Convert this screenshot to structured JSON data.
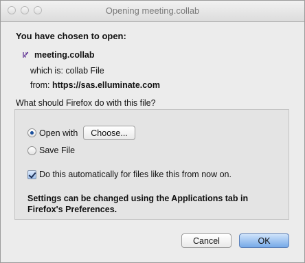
{
  "window": {
    "title": "Opening meeting.collab"
  },
  "dialog": {
    "heading": "You have chosen to open:",
    "file_name": "meeting.collab",
    "which_is_label": "which is:",
    "which_is_value": "collab File",
    "from_label": "from:",
    "from_value": "https://sas.elluminate.com",
    "question": "What should Firefox do with this file?"
  },
  "options": {
    "open_with_label": "Open with",
    "choose_button": "Choose...",
    "save_file_label": "Save File",
    "auto_label": "Do this automatically for files like this from now on.",
    "settings_note": "Settings can be changed using the Applications tab in Firefox's Preferences.",
    "selected": "open_with",
    "auto_checked": true
  },
  "buttons": {
    "cancel": "Cancel",
    "ok": "OK"
  },
  "colors": {
    "accent": "#76a9e8",
    "window_bg": "#ececec"
  },
  "icons": {
    "file": "collab-file-icon"
  }
}
